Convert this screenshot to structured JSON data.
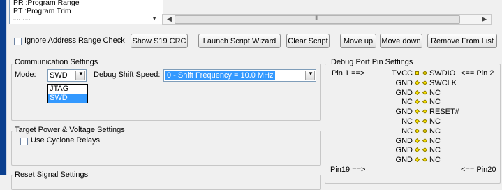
{
  "range_list": {
    "items": [
      "PR  :Program Range",
      "PT  :Program Trim"
    ],
    "scroll_down_icon": "down-arrow-icon"
  },
  "hscroll": {
    "left_icon": "left-arrow",
    "right_icon": "right-arrow",
    "grip": "III"
  },
  "toolbar": {
    "ignore_check_label": "Ignore Address Range Check",
    "show_s19_crc": "Show S19 CRC",
    "launch_script_wizard": "Launch Script  Wizard",
    "clear_script": "Clear Script",
    "move_up": "Move up",
    "move_down": "Move down",
    "remove_from_list": "Remove From List"
  },
  "comm": {
    "title": "Communication Settings",
    "mode_label": "Mode:",
    "mode_value": "SWD",
    "mode_options": [
      "JTAG",
      "SWD"
    ],
    "shift_speed_label": "Debug Shift Speed:",
    "shift_speed_value": "0 - Shift Frequency   = 10.0 MHz"
  },
  "power": {
    "title": "Target Power & Voltage Settings",
    "use_relays_label": "Use Cyclone Relays"
  },
  "reset": {
    "title": "Reset Signal Settings"
  },
  "pins": {
    "title": "Debug Port Pin Settings",
    "pin1_label": "Pin 1 ==>",
    "pin2_label": "<== Pin 2",
    "pin19_label": "Pin19 ==>",
    "pin20_label": "<== Pin20",
    "rows": [
      {
        "left": "TVCC",
        "right": "SWDIO"
      },
      {
        "left": "GND",
        "right": "SWCLK"
      },
      {
        "left": "GND",
        "right": "NC"
      },
      {
        "left": "NC",
        "right": "NC"
      },
      {
        "left": "GND",
        "right": "RESET#"
      },
      {
        "left": "NC",
        "right": "NC"
      },
      {
        "left": "NC",
        "right": "NC"
      },
      {
        "left": "GND",
        "right": "NC"
      },
      {
        "left": "GND",
        "right": "NC"
      },
      {
        "left": "GND",
        "right": "NC"
      }
    ],
    "marker_color": "#ffe600"
  }
}
